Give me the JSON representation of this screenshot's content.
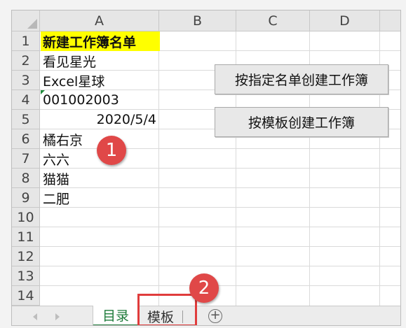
{
  "columns": [
    "A",
    "B",
    "C",
    "D"
  ],
  "rows": [
    "1",
    "2",
    "3",
    "4",
    "5",
    "6",
    "7",
    "8",
    "9",
    "10",
    "11",
    "12",
    "13",
    "14"
  ],
  "cells": {
    "a1": "新建工作簿名单",
    "a2": "看见星光",
    "a3": "Excel星球",
    "a4": "001002003",
    "a5": "2020/5/4",
    "a6": "橘右京",
    "a7": "六六",
    "a8": "猫猫",
    "a9": "二肥"
  },
  "colors": {
    "title_highlight": "#ffff00",
    "badge": "#e04848",
    "active_tab": "#1e7b3a",
    "highlight_box": "#e03c3c"
  },
  "buttons": {
    "create_by_list": "按指定名单创建工作簿",
    "create_by_template": "按模板创建工作簿"
  },
  "badges": {
    "one": "1",
    "two": "2"
  },
  "tabs": {
    "sheet1": "目录",
    "sheet2": "模板",
    "add": "+"
  }
}
